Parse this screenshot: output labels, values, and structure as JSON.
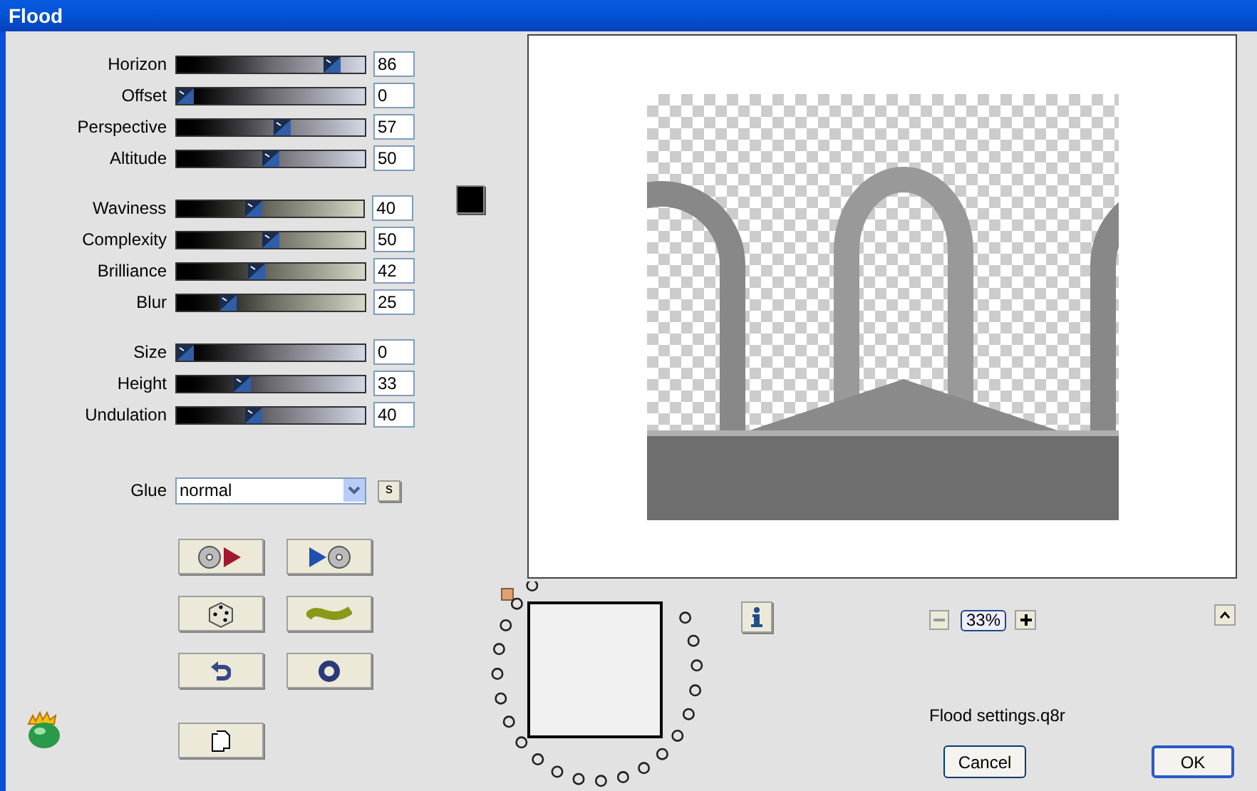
{
  "window": {
    "title": "Flood"
  },
  "slider_groups": [
    [
      {
        "label": "Horizon",
        "value": "86",
        "level": 0.86
      },
      {
        "label": "Offset",
        "value": "0",
        "level": 0
      },
      {
        "label": "Perspective",
        "value": "57",
        "level": 0.57
      },
      {
        "label": "Altitude",
        "value": "50",
        "level": 0.5
      }
    ],
    [
      {
        "label": "Waviness",
        "value": "40",
        "level": 0.4
      },
      {
        "label": "Complexity",
        "value": "50",
        "level": 0.5
      },
      {
        "label": "Brilliance",
        "value": "42",
        "level": 0.42
      },
      {
        "label": "Blur",
        "value": "25",
        "level": 0.25
      }
    ],
    [
      {
        "label": "Size",
        "value": "0",
        "level": 0
      },
      {
        "label": "Height",
        "value": "33",
        "level": 0.33
      },
      {
        "label": "Undulation",
        "value": "40",
        "level": 0.4
      }
    ]
  ],
  "color_swatch": {
    "color": "#000000"
  },
  "glue": {
    "label": "Glue",
    "value": "normal",
    "side_button": "s"
  },
  "zoom": {
    "value": "33%"
  },
  "preset_file": "Flood settings.q8r",
  "buttons": [
    "Cancel",
    "OK"
  ]
}
